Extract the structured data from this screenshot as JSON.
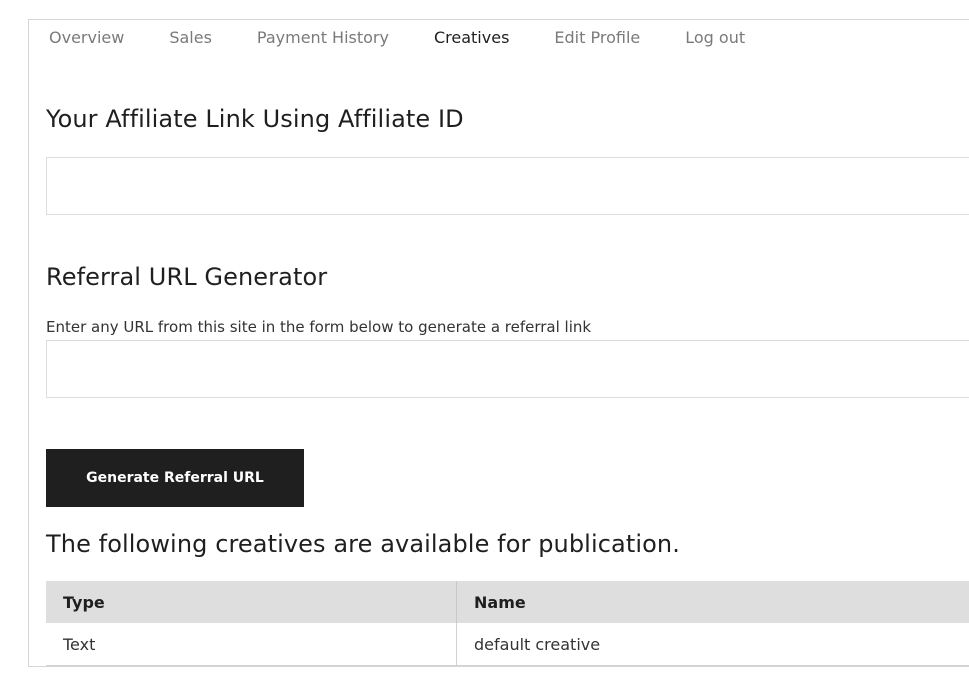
{
  "nav": {
    "tabs": [
      {
        "label": "Overview"
      },
      {
        "label": "Sales"
      },
      {
        "label": "Payment History"
      },
      {
        "label": "Creatives"
      },
      {
        "label": "Edit Profile"
      },
      {
        "label": "Log out"
      }
    ],
    "active_tab": "Creatives"
  },
  "affiliate": {
    "heading": "Your Affiliate Link Using Affiliate ID",
    "link_value": ""
  },
  "referral": {
    "heading": "Referral URL Generator",
    "help_text": "Enter any URL from this site in the form below to generate a referral link",
    "url_value": "",
    "generate_label": "Generate Referral URL"
  },
  "creatives": {
    "heading": "The following creatives are available for publication.",
    "columns": [
      "Type",
      "Name"
    ],
    "rows": [
      {
        "type": "Text",
        "name": "default creative"
      }
    ]
  },
  "colors": {
    "button_bg": "#1f1f1f",
    "table_header_bg": "#dedede",
    "tab_inactive": "#7a7a7a",
    "tab_active": "#1f1f1f"
  }
}
